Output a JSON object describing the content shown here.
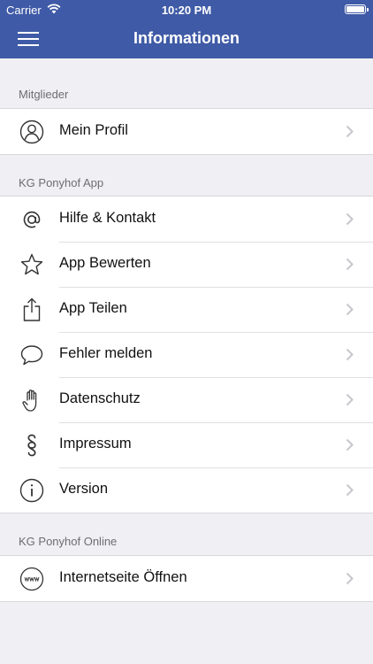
{
  "status_bar": {
    "carrier": "Carrier",
    "time": "10:20 PM"
  },
  "nav": {
    "title": "Informationen",
    "menu_icon": "hamburger-menu-icon"
  },
  "colors": {
    "nav_background": "#3f5aa6",
    "page_background": "#efeff4",
    "section_header_text": "#6d6d72",
    "chevron": "#c7c7cc"
  },
  "sections": [
    {
      "header": "Mitglieder",
      "items": [
        {
          "label": "Mein Profil",
          "icon": "user-profile-icon"
        }
      ]
    },
    {
      "header": "KG Ponyhof App",
      "items": [
        {
          "label": "Hilfe & Kontakt",
          "icon": "at-sign-icon"
        },
        {
          "label": "App Bewerten",
          "icon": "star-icon"
        },
        {
          "label": "App Teilen",
          "icon": "share-icon"
        },
        {
          "label": "Fehler melden",
          "icon": "speech-bubble-icon"
        },
        {
          "label": "Datenschutz",
          "icon": "hand-icon"
        },
        {
          "label": "Impressum",
          "icon": "section-sign-icon"
        },
        {
          "label": "Version",
          "icon": "info-icon"
        }
      ]
    },
    {
      "header": "KG Ponyhof Online",
      "items": [
        {
          "label": "Internetseite Öffnen",
          "icon": "www-icon"
        }
      ]
    }
  ]
}
